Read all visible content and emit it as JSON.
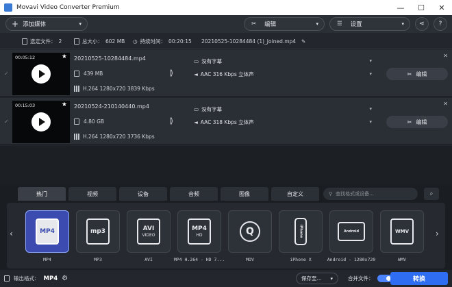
{
  "window": {
    "title": "Movavi Video Converter Premium",
    "controls": [
      "—",
      "☐",
      "✕"
    ]
  },
  "toolbar": {
    "add_media": "添加媒体",
    "edit": "编辑",
    "settings": "设置"
  },
  "info": {
    "selected_label": "选定文件：",
    "selected_value": "2",
    "size_label": "总大小：",
    "size_value": "602 MB",
    "duration_label": "持续时间：",
    "duration_value": "00:20:15",
    "output_name": "20210525-10284484 (1)_Joined.mp4"
  },
  "files": [
    {
      "time": "00:05:12",
      "name": "20210525-10284484.mp4",
      "size": "439 MB",
      "codec": "H.264 1280x720 3839 Kbps",
      "subtitle": "没有字幕",
      "audio": "AAC 316 Kbps 立体声",
      "edit": "编辑"
    },
    {
      "time": "00:15:03",
      "name": "20210524-210140440.mp4",
      "size": "4.80 GB",
      "codec": "H.264 1280x720 3736 Kbps",
      "subtitle": "没有字幕",
      "audio": "AAC 318 Kbps 立体声",
      "edit": "编辑"
    }
  ],
  "format_tabs": [
    "热门",
    "视频",
    "设备",
    "音频",
    "图像",
    "自定义"
  ],
  "format_search": {
    "placeholder": "查找格式或设备..."
  },
  "presets": [
    {
      "icon": "MP4",
      "sub": "",
      "label": "MP4"
    },
    {
      "icon": "mp3",
      "sub": "",
      "label": "MP3"
    },
    {
      "icon": "AVI",
      "sub": "VIDEO",
      "label": "AVI"
    },
    {
      "icon": "MP4",
      "sub": "HD",
      "label": "MP4 H.264 - HD 7..."
    },
    {
      "icon": "Q",
      "sub": "",
      "label": "MOV"
    },
    {
      "icon": "iPhone",
      "sub": "",
      "label": "iPhone X"
    },
    {
      "icon": "Android",
      "sub": "",
      "label": "Android - 1280x720"
    },
    {
      "icon": "WMV",
      "sub": "",
      "label": "WMV"
    }
  ],
  "bottom": {
    "output_format_label": "输出格式：",
    "output_format_value": "MP4",
    "save_to": "保存至...",
    "merge_label": "合并文件：",
    "convert": "转换"
  }
}
